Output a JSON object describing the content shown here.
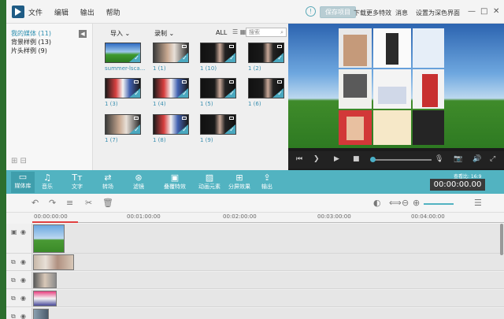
{
  "menu": [
    "文件",
    "编辑",
    "输出",
    "帮助"
  ],
  "titlebar": {
    "save_project": "保存项目",
    "download_effects": "下载更多特效",
    "messages": "消息",
    "set_default": "设置为深色界面"
  },
  "library": {
    "items": [
      {
        "label": "我的媒体 (11)",
        "active": true
      },
      {
        "label": "背景样例 (13)",
        "active": false
      },
      {
        "label": "片头样例 (9)",
        "active": false
      }
    ]
  },
  "media_toolbar": {
    "import": "导入",
    "record": "录制",
    "all": "ALL",
    "search_placeholder": "搜索"
  },
  "media_items": [
    {
      "label": "summer-lsca...",
      "kind": "landscape"
    },
    {
      "label": "1 (1)",
      "kind": "people"
    },
    {
      "label": "1 (10)",
      "kind": "dark"
    },
    {
      "label": "1 (2)",
      "kind": "dark"
    },
    {
      "label": "1 (3)",
      "kind": "poster"
    },
    {
      "label": "1 (4)",
      "kind": "poster"
    },
    {
      "label": "1 (5)",
      "kind": "dark"
    },
    {
      "label": "1 (6)",
      "kind": "dark"
    },
    {
      "label": "1 (7)",
      "kind": "people"
    },
    {
      "label": "1 (8)",
      "kind": "poster"
    },
    {
      "label": "1 (9)",
      "kind": "dark"
    }
  ],
  "toolbar": {
    "tools": [
      "媒体库",
      "音乐",
      "文字",
      "转场",
      "滤镜",
      "叠覆特效",
      "动画元素",
      "分屏效果",
      "输出"
    ],
    "timecode_label": "查看比: 16:9",
    "timecode": "00:00:00.00"
  },
  "timeline": {
    "ticks": [
      "00:00:00:00",
      "00:01:00:00",
      "00:02:00:00",
      "00:03:00:00",
      "00:04:00:00"
    ]
  },
  "colors": {
    "accent": "#52b3c1",
    "check": "#4aa8bf"
  }
}
